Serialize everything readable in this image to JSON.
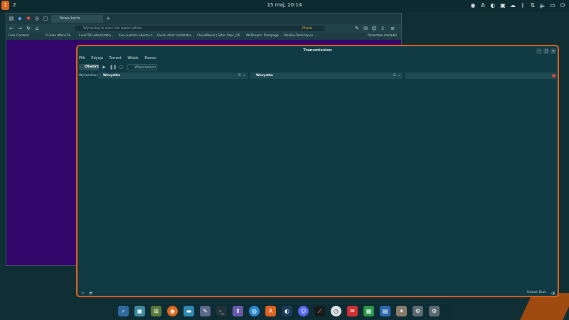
{
  "top_panel": {
    "workspaces": [
      "1",
      "2"
    ],
    "clock": "15 maj, 20:14"
  },
  "browser": {
    "tab_title": "Nowa karta",
    "url_placeholder": "Wyszukaj w sieci lub wpisz adres",
    "url_badge": "Praca",
    "bookmarks": [
      "Free Content",
      "Pi-hole MikroTik",
      "LiveCDCustomizatio...",
      "live-custom-ubuntu-f...",
      "Quick start installatio...",
      "CloudPanel | Sites",
      "Pop!_OS",
      "MxDream: Rampage ...",
      "Polskie-Torrenty.eu -..."
    ],
    "other_bookmarks": "Pozostałe zakładki"
  },
  "transmission": {
    "title": "Transmission",
    "menu": [
      "Plik",
      "Edycja",
      "Torrent",
      "Widok",
      "Pomoc"
    ],
    "open_label": "Otwórz",
    "properties_label": "Właściwości",
    "filter_label": "Wyświetlanie:",
    "filter1": {
      "value": "Wszystko",
      "count": "0"
    },
    "filter2": {
      "value": "Wszystko",
      "count": "0"
    },
    "status": "Udział: Brak"
  },
  "colors": {
    "accent": "#e0641e",
    "window_bg": "#0f3a44",
    "browser_bg": "#32066a"
  }
}
